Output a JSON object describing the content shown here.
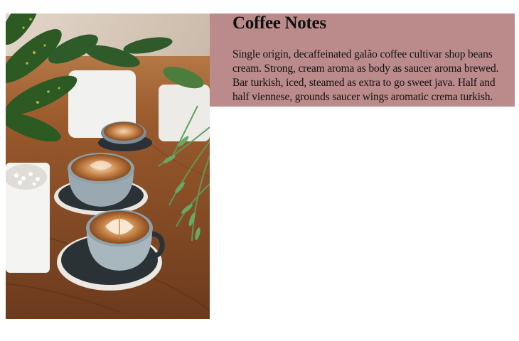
{
  "photo": {
    "subject": "coffee-cups-with-plants",
    "icon": "photo-image"
  },
  "card": {
    "title": "Coffee Notes",
    "body": "Single origin, decaffeinated galão coffee cultivar shop beans cream. Strong, cream aroma as body as saucer aroma brewed. Bar turkish, iced, steamed as extra to go sweet java. Half and half viennese, grounds saucer wings aromatic crema turkish.",
    "background_color": "#bb8b8b"
  },
  "colors": {
    "page_background": "#ffffff",
    "text": "#111111",
    "card_background": "#bb8b8b"
  }
}
